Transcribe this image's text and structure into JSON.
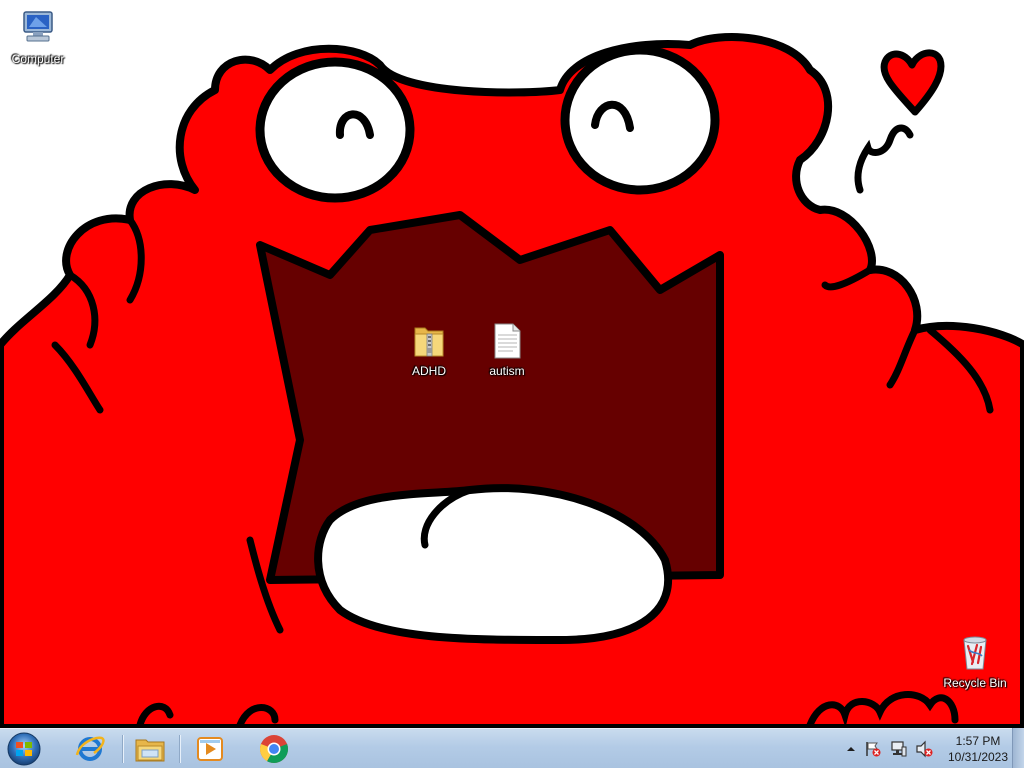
{
  "desktop": {
    "icons": {
      "computer": {
        "label": "Computer"
      },
      "adhd": {
        "label": "ADHD"
      },
      "autism": {
        "label": "autism"
      },
      "recycle_bin": {
        "label": "Recycle Bin"
      }
    }
  },
  "taskbar": {
    "pinned": [
      "start-orb-icon",
      "internet-explorer-icon",
      "windows-explorer-icon",
      "media-player-icon",
      "chrome-icon"
    ],
    "tray": {
      "icons": [
        "show-hidden-icons-icon",
        "action-center-flag-icon",
        "network-icon",
        "volume-muted-icon"
      ],
      "time": "1:57 PM",
      "date": "10/31/2023"
    }
  },
  "colors": {
    "wallpaper_red": "#ff0000",
    "mouth_dark": "#660000",
    "taskbar": "#b3cbe6"
  }
}
